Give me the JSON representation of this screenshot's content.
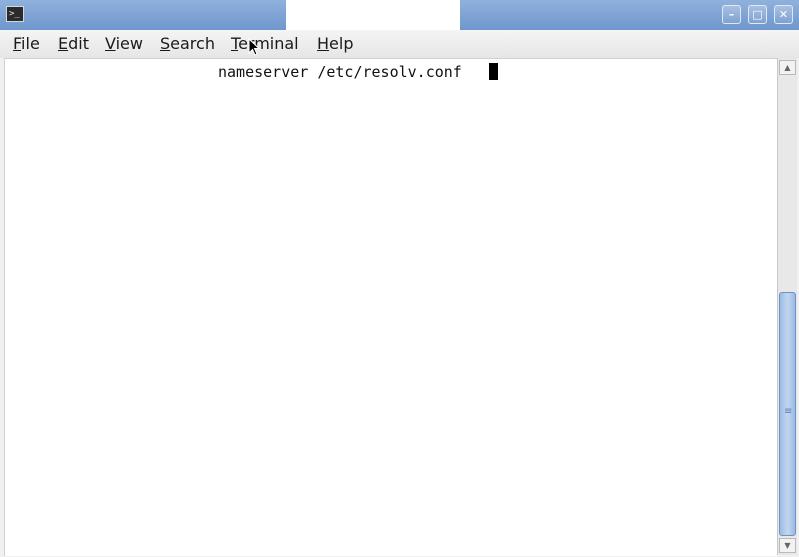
{
  "window": {
    "icon": "terminal-icon",
    "controls": [
      {
        "name": "minimize-button",
        "icon": "minimize-icon",
        "glyph": "–"
      },
      {
        "name": "maximize-button",
        "icon": "maximize-icon",
        "glyph": "□"
      },
      {
        "name": "close-button",
        "icon": "close-icon",
        "glyph": "✕"
      }
    ]
  },
  "menu": {
    "items": [
      "File",
      "Edit",
      "View",
      "Search",
      "Terminal",
      "Help"
    ]
  },
  "terminal": {
    "line": "nameserver /etc/resolv.conf "
  },
  "colors": {
    "titlebar": "#7fa2d2",
    "scroll_thumb": "#9cbbe3",
    "background": "#ffffff"
  }
}
